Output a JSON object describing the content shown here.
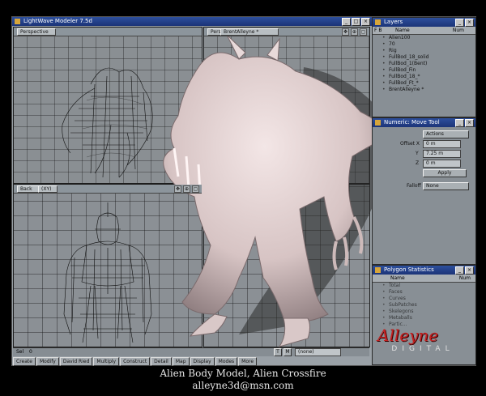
{
  "app": {
    "title": "LightWave Modeler 7.5d"
  },
  "viewports": {
    "top_left": {
      "mode": "Perspective"
    },
    "top_right": {
      "mode": "Perspective",
      "surface": "BrentAlleyne *"
    },
    "bottom_left": {
      "mode": "Back",
      "axis": "(XY)"
    }
  },
  "layers": {
    "title": "Layers",
    "col_name": "Name",
    "col_num": "Num",
    "items": [
      "Alien100",
      "70",
      "Rig",
      "FullBod_18_solid",
      "FullBod_1(Bent)",
      "FullBod_Fin",
      "FullBod_18_*",
      "FullBod_Ft_*",
      "BrentAlleyne *"
    ]
  },
  "numeric": {
    "title": "Numeric: Move Tool",
    "actions": "Actions",
    "offset_label": "Offset X",
    "x_value": "0 m",
    "y_label": "Y",
    "y_value": "7.25 m",
    "z_label": "Z",
    "z_value": "0 m",
    "apply": "Apply",
    "falloff_label": "Falloff",
    "falloff_value": "None"
  },
  "poly_stats": {
    "title": "Polygon Statistics",
    "col_name": "Name",
    "col_num": "Num",
    "rows": [
      "Total",
      "Faces",
      "Curves",
      "SubPatches",
      "Skelegons",
      "Metaballs",
      "Partic..."
    ]
  },
  "statusbar": {
    "sel_label": "Sel",
    "sel_value": "0",
    "snap": "(none)"
  },
  "toolbar": [
    "Create",
    "Modify",
    "David Ried",
    "Multiply",
    "Construct",
    "Detail",
    "Map",
    "Display",
    "Modes",
    "More"
  ],
  "logo": {
    "text": "Alleyne",
    "sub": "DIGITAL"
  },
  "caption": {
    "line1": "Alien Body Model, Alien Crossfire",
    "line2": "alleyne3d@msn.com"
  },
  "colors": {
    "titlebar": "#1c3478",
    "panel": "#888f95",
    "alien": "#e2d2d2",
    "logo_red": "#c42020"
  }
}
